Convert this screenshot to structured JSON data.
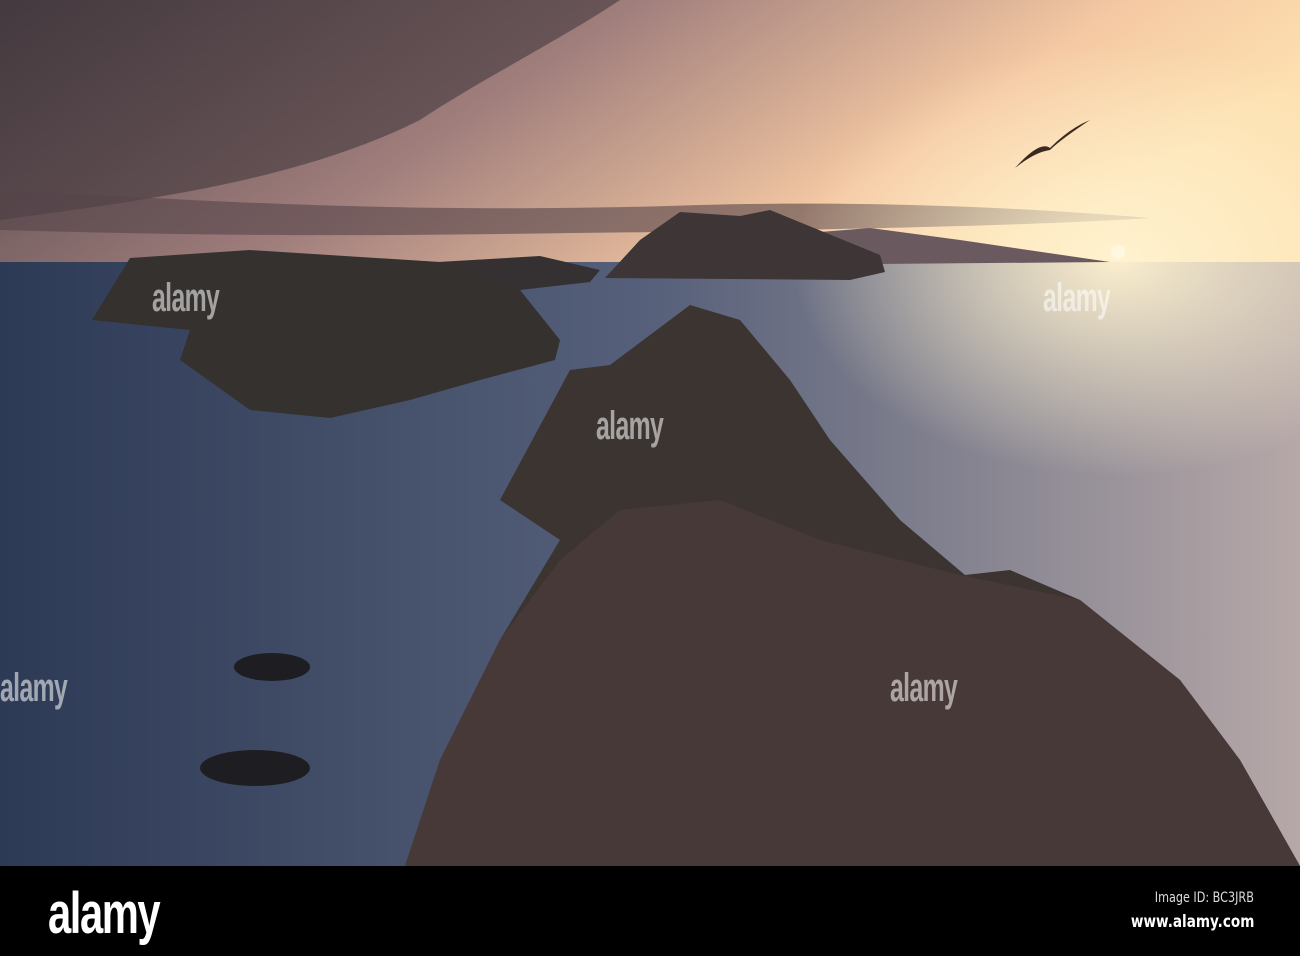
{
  "watermark": "alamy",
  "footer": {
    "logo": "alamy",
    "image_id": "Image ID: BC3JRB",
    "website": "www.alamy.com"
  },
  "colors": {
    "sky_top": "#5a4a4e",
    "sky_glow": "#f6c79a",
    "sea": "#3f5068",
    "rock": "#3a3532",
    "footer": "#000000"
  }
}
